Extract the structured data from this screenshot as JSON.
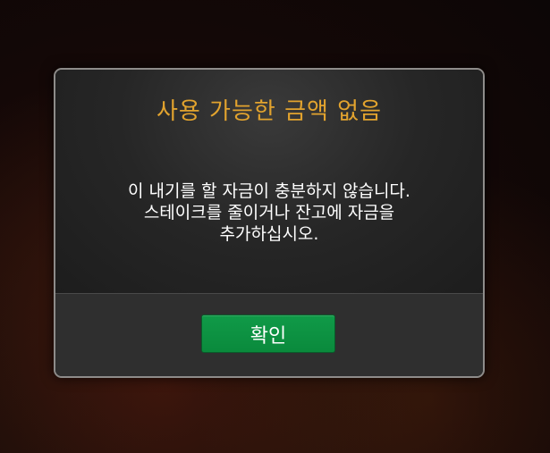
{
  "dialog": {
    "title": "사용 가능한 금액 없음",
    "message": "이 내기를 할 자금이 충분하지 않습니다.\n스테이크를 줄이거나 잔고에 자금을\n추가하십시오.",
    "confirm_label": "확인"
  },
  "colors": {
    "title": "#e2a32e",
    "button": "#0f9444",
    "border": "#8e8c8a"
  }
}
